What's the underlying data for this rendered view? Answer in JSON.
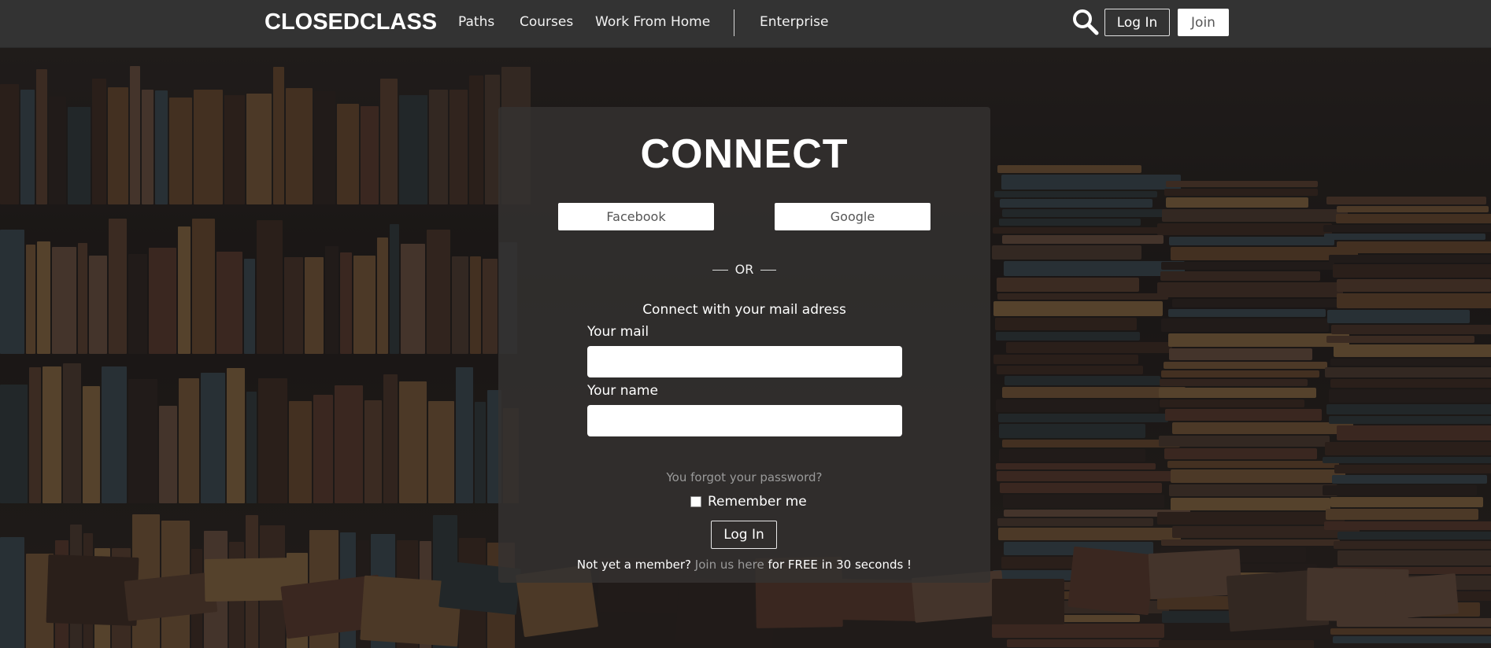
{
  "nav": {
    "brand": "CLOSEDCLASS",
    "links": [
      "Paths",
      "Courses",
      "Work From Home",
      "Enterprise"
    ],
    "login_label": "Log In",
    "join_label": "Join"
  },
  "panel": {
    "title": "CONNECT",
    "facebook_label": "Facebook",
    "google_label": "Google",
    "or_label": "OR",
    "subtitle": "Connect with your mail adress",
    "mail_label": "Your mail",
    "name_label": "Your name",
    "mail_value": "",
    "name_value": "",
    "forgot_label": "You forgot your password?",
    "remember_label": "Remember me",
    "remember_checked": false,
    "login_label": "Log In",
    "member_prefix": "Not yet a member?",
    "member_link": "Join us here",
    "member_suffix": "for FREE in 30 seconds !"
  },
  "colors": {
    "nav_bg": "#333333",
    "panel_bg": "rgba(52,50,49,0.82)",
    "link_muted": "#9a9a9a"
  },
  "icons": {
    "search": "search-icon"
  }
}
